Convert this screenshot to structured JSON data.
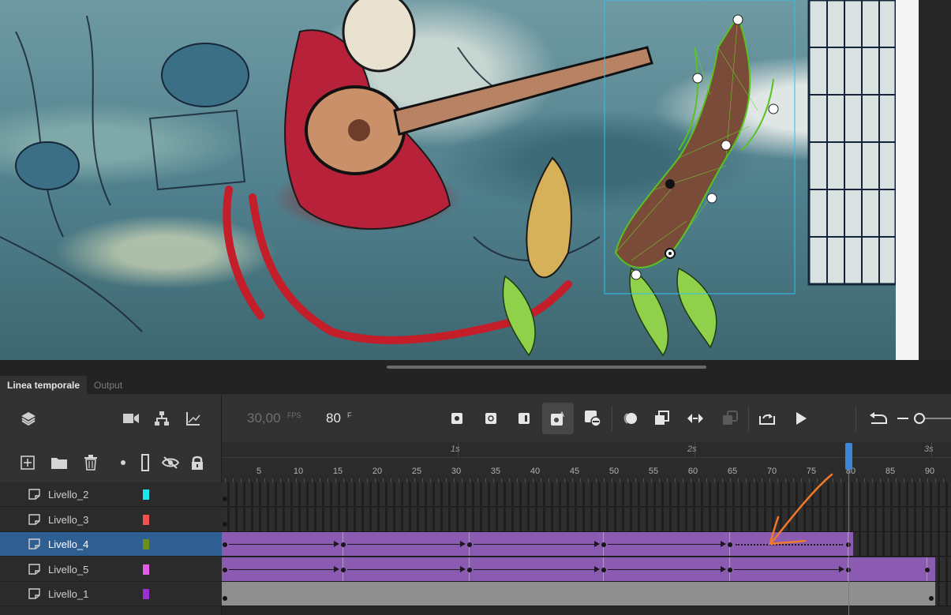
{
  "panel_tabs": [
    {
      "label": "Linea temporale",
      "active": true
    },
    {
      "label": "Output",
      "active": false
    }
  ],
  "toolbar": {
    "fps_value": "30,00",
    "fps_unit": "FPS",
    "current_frame": "80",
    "frame_unit": "F",
    "icons": [
      "layers-icon",
      "camera-icon",
      "layer-parenting-icon",
      "graph-icon",
      "insert-keyframe-icon",
      "insert-blank-keyframe-icon",
      "insert-frame-icon",
      "auto-keyframe-icon",
      "remove-frame-icon",
      "onion-skin-icon",
      "edit-multiple-frames-icon",
      "create-tween-icon",
      "convert-icon",
      "loop-icon",
      "play-icon",
      "undo-icon",
      "zoom-slider-icon"
    ]
  },
  "layer_toolbar": {
    "icons": [
      "new-layer-icon",
      "new-folder-icon",
      "delete-icon",
      "highlight-icon",
      "outline-icon",
      "hide-icon",
      "lock-icon"
    ]
  },
  "ruler": {
    "seconds": [
      "1s",
      "2s",
      "3s"
    ],
    "frames": [
      "5",
      "10",
      "15",
      "20",
      "25",
      "30",
      "35",
      "40",
      "45",
      "50",
      "55",
      "60",
      "65",
      "70",
      "75",
      "80",
      "85",
      "90"
    ]
  },
  "layers": [
    {
      "name": "Livello_2",
      "color": "#19e8ee",
      "selected": false
    },
    {
      "name": "Livello_3",
      "color": "#f0514f",
      "selected": false
    },
    {
      "name": "Livello_4",
      "color": "#6f8f1c",
      "selected": true
    },
    {
      "name": "Livello_5",
      "color": "#e55ce7",
      "selected": false
    },
    {
      "name": "Livello_1",
      "color": "#9c2fd0",
      "selected": false
    }
  ],
  "playhead_frame": 80,
  "accent": "#3c86d8",
  "tween_color": "#8a5bb1",
  "annotation_color": "#f07a2a"
}
